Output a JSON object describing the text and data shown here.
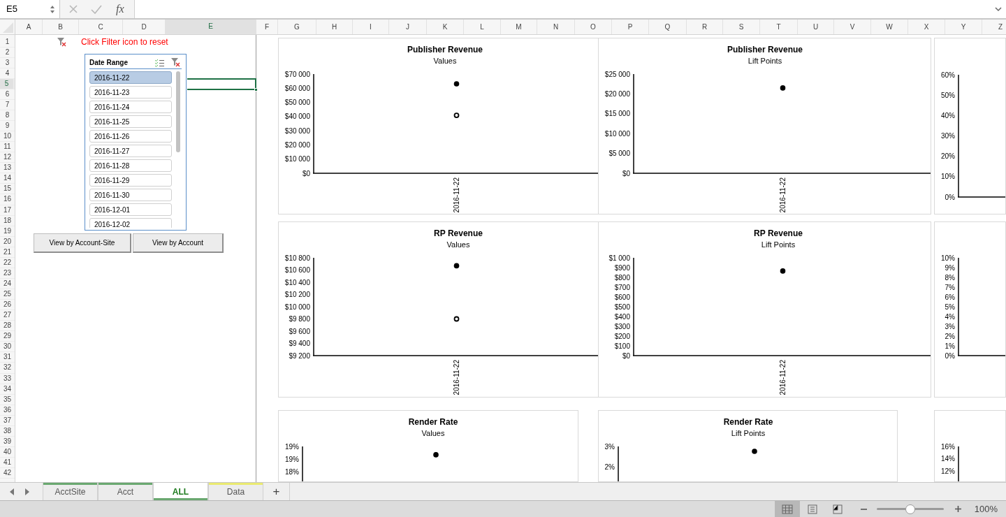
{
  "formula_bar": {
    "name_box": "E5",
    "function_label": "fx"
  },
  "columns": [
    {
      "label": "A",
      "selected": false
    },
    {
      "label": "B",
      "selected": false
    },
    {
      "label": "C",
      "selected": false
    },
    {
      "label": "D",
      "selected": false
    },
    {
      "label": "E",
      "selected": true
    },
    {
      "label": "F",
      "selected": false
    },
    {
      "label": "G",
      "selected": false
    },
    {
      "label": "H",
      "selected": false
    },
    {
      "label": "I",
      "selected": false
    },
    {
      "label": "J",
      "selected": false
    },
    {
      "label": "K",
      "selected": false
    },
    {
      "label": "L",
      "selected": false
    },
    {
      "label": "M",
      "selected": false
    },
    {
      "label": "N",
      "selected": false
    },
    {
      "label": "O",
      "selected": false
    },
    {
      "label": "P",
      "selected": false
    },
    {
      "label": "Q",
      "selected": false
    },
    {
      "label": "R",
      "selected": false
    },
    {
      "label": "S",
      "selected": false
    },
    {
      "label": "T",
      "selected": false
    },
    {
      "label": "U",
      "selected": false
    },
    {
      "label": "V",
      "selected": false
    },
    {
      "label": "W",
      "selected": false
    },
    {
      "label": "X",
      "selected": false
    },
    {
      "label": "Y",
      "selected": false
    },
    {
      "label": "Z",
      "selected": false
    }
  ],
  "rows": [
    {
      "label": "1",
      "selected": false
    },
    {
      "label": "2",
      "selected": false
    },
    {
      "label": "3",
      "selected": false
    },
    {
      "label": "4",
      "selected": false
    },
    {
      "label": "5",
      "selected": true
    },
    {
      "label": "6",
      "selected": false
    },
    {
      "label": "7",
      "selected": false
    },
    {
      "label": "8",
      "selected": false
    },
    {
      "label": "9",
      "selected": false
    },
    {
      "label": "10",
      "selected": false
    },
    {
      "label": "11",
      "selected": false
    },
    {
      "label": "12",
      "selected": false
    },
    {
      "label": "13",
      "selected": false
    },
    {
      "label": "14",
      "selected": false
    },
    {
      "label": "15",
      "selected": false
    },
    {
      "label": "16",
      "selected": false
    },
    {
      "label": "17",
      "selected": false
    },
    {
      "label": "18",
      "selected": false
    },
    {
      "label": "19",
      "selected": false
    },
    {
      "label": "20",
      "selected": false
    },
    {
      "label": "21",
      "selected": false
    },
    {
      "label": "22",
      "selected": false
    },
    {
      "label": "23",
      "selected": false
    },
    {
      "label": "24",
      "selected": false
    },
    {
      "label": "25",
      "selected": false
    },
    {
      "label": "26",
      "selected": false
    },
    {
      "label": "27",
      "selected": false
    },
    {
      "label": "28",
      "selected": false
    },
    {
      "label": "29",
      "selected": false
    },
    {
      "label": "30",
      "selected": false
    },
    {
      "label": "31",
      "selected": false
    },
    {
      "label": "32",
      "selected": false
    },
    {
      "label": "33",
      "selected": false
    },
    {
      "label": "34",
      "selected": false
    },
    {
      "label": "35",
      "selected": false
    },
    {
      "label": "36",
      "selected": false
    },
    {
      "label": "37",
      "selected": false
    },
    {
      "label": "38",
      "selected": false
    },
    {
      "label": "39",
      "selected": false
    },
    {
      "label": "40",
      "selected": false
    },
    {
      "label": "41",
      "selected": false
    },
    {
      "label": "42",
      "selected": false
    }
  ],
  "reset_note": "Click Filter icon to reset",
  "slicer": {
    "title": "Date Range",
    "items": [
      {
        "label": "2016-11-22",
        "selected": true
      },
      {
        "label": "2016-11-23",
        "selected": false
      },
      {
        "label": "2016-11-24",
        "selected": false
      },
      {
        "label": "2016-11-25",
        "selected": false
      },
      {
        "label": "2016-11-26",
        "selected": false
      },
      {
        "label": "2016-11-27",
        "selected": false
      },
      {
        "label": "2016-11-28",
        "selected": false
      },
      {
        "label": "2016-11-29",
        "selected": false
      },
      {
        "label": "2016-11-30",
        "selected": false
      },
      {
        "label": "2016-12-01",
        "selected": false
      },
      {
        "label": "2016-12-02",
        "selected": false
      }
    ]
  },
  "buttons": [
    "View by Account-Site",
    "View by Account"
  ],
  "charts": [
    {
      "subtitle": "Values",
      "x_label": "2016-11-22",
      "chart_data": {
        "type": "scatter",
        "title": "Publisher Revenue",
        "categories": [
          null
        ],
        "ylim": [
          0,
          70000
        ],
        "yticks": [
          {
            "value": 70000,
            "label": "$70 000"
          },
          {
            "value": 60000,
            "label": "$60 000"
          },
          {
            "value": 50000,
            "label": "$50 000"
          },
          {
            "value": 40000,
            "label": "$40 000"
          },
          {
            "value": 30000,
            "label": "$30 000"
          },
          {
            "value": 20000,
            "label": "$20 000"
          },
          {
            "value": 10000,
            "label": "$10 000"
          },
          {
            "value": 0,
            "label": "$0"
          }
        ],
        "series": [
          {
            "marker": "circle",
            "color": "#000000",
            "values": [
              63100
            ]
          },
          {
            "marker": "circle",
            "color": "#ffffff",
            "values": [
              40900
            ]
          }
        ]
      }
    },
    {
      "subtitle": "Lift Points",
      "x_label": "2016-11-22",
      "chart_data": {
        "type": "scatter",
        "title": "Publisher Revenue",
        "categories": [
          null
        ],
        "ylim": [
          0,
          25000
        ],
        "yticks": [
          {
            "value": 25000,
            "label": "$25 000"
          },
          {
            "value": 20000,
            "label": "$20 000"
          },
          {
            "value": 15000,
            "label": "$15 000"
          },
          {
            "value": 10000,
            "label": "$10 000"
          },
          {
            "value": 5000,
            "label": "$5 000"
          },
          {
            "value": 0,
            "label": "$0"
          }
        ],
        "series": [
          {
            "marker": "circle",
            "color": "#000000",
            "values": [
              21500
            ]
          }
        ]
      }
    },
    {
      "chart_data": {
        "type": "scatter",
        "categories": [
          null
        ],
        "ylim": [
          0,
          0.6
        ],
        "yticks": [
          {
            "value": 0.6,
            "label": "60%"
          },
          {
            "value": 0.5,
            "label": "50%"
          },
          {
            "value": 0.4,
            "label": "40%"
          },
          {
            "value": 0.3,
            "label": "30%"
          },
          {
            "value": 0.2,
            "label": "20%"
          },
          {
            "value": 0.1,
            "label": "10%"
          },
          {
            "value": 0,
            "label": "0%"
          }
        ]
      }
    },
    {
      "subtitle": "Values",
      "x_label": "2016-11-22",
      "chart_data": {
        "type": "scatter",
        "title": "RP Revenue",
        "categories": [
          null
        ],
        "ylim": [
          9200,
          10800
        ],
        "yticks": [
          {
            "value": 10800,
            "label": "$10 800"
          },
          {
            "value": 10600,
            "label": "$10 600"
          },
          {
            "value": 10400,
            "label": "$10 400"
          },
          {
            "value": 10200,
            "label": "$10 200"
          },
          {
            "value": 10000,
            "label": "$10 000"
          },
          {
            "value": 9800,
            "label": "$9 800"
          },
          {
            "value": 9600,
            "label": "$9 600"
          },
          {
            "value": 9400,
            "label": "$9 400"
          },
          {
            "value": 9200,
            "label": "$9 200"
          }
        ],
        "series": [
          {
            "marker": "circle",
            "color": "#000000",
            "values": [
              10670
            ]
          },
          {
            "marker": "circle",
            "color": "#ffffff",
            "values": [
              9800
            ]
          }
        ]
      }
    },
    {
      "subtitle": "Lift Points",
      "x_label": "2016-11-22",
      "chart_data": {
        "type": "scatter",
        "title": "RP Revenue",
        "categories": [
          null
        ],
        "ylim": [
          0,
          1000
        ],
        "yticks": [
          {
            "value": 1000,
            "label": "$1 000"
          },
          {
            "value": 900,
            "label": "$900"
          },
          {
            "value": 800,
            "label": "$800"
          },
          {
            "value": 700,
            "label": "$700"
          },
          {
            "value": 600,
            "label": "$600"
          },
          {
            "value": 500,
            "label": "$500"
          },
          {
            "value": 400,
            "label": "$400"
          },
          {
            "value": 300,
            "label": "$300"
          },
          {
            "value": 200,
            "label": "$200"
          },
          {
            "value": 100,
            "label": "$100"
          },
          {
            "value": 0,
            "label": "$0"
          }
        ],
        "series": [
          {
            "marker": "circle",
            "color": "#000000",
            "values": [
              865
            ]
          }
        ]
      }
    },
    {
      "chart_data": {
        "type": "scatter",
        "categories": [
          null
        ],
        "ylim": [
          0,
          0.1
        ],
        "yticks": [
          {
            "value": 0.1,
            "label": "10%"
          },
          {
            "value": 0.09,
            "label": "9%"
          },
          {
            "value": 0.08,
            "label": "8%"
          },
          {
            "value": 0.07,
            "label": "7%"
          },
          {
            "value": 0.06,
            "label": "6%"
          },
          {
            "value": 0.05,
            "label": "5%"
          },
          {
            "value": 0.04,
            "label": "4%"
          },
          {
            "value": 0.03,
            "label": "3%"
          },
          {
            "value": 0.02,
            "label": "2%"
          },
          {
            "value": 0.01,
            "label": "1%"
          },
          {
            "value": 0,
            "label": "0%"
          }
        ]
      }
    },
    {
      "subtitle": "Values",
      "chart_data": {
        "type": "scatter",
        "title": "Render Rate",
        "categories": [
          null
        ],
        "ylim": [
          0.1786,
          0.193
        ],
        "yticks": [
          {
            "value": 0.193,
            "label": "19%"
          },
          {
            "value": 0.188,
            "label": "19%"
          },
          {
            "value": 0.183,
            "label": "18%"
          }
        ],
        "series": [
          {
            "marker": "circle",
            "color": "#000000",
            "values": [
              0.1897
            ]
          }
        ]
      }
    },
    {
      "subtitle": "Lift Points",
      "chart_data": {
        "type": "scatter",
        "title": "Render Rate",
        "categories": [
          null
        ],
        "ylim": [
          0.0121,
          0.03
        ],
        "yticks": [
          {
            "value": 0.03,
            "label": "3%"
          },
          {
            "value": 0.02,
            "label": "2%"
          }
        ],
        "series": [
          {
            "marker": "circle",
            "color": "#000000",
            "values": [
              0.0276
            ]
          }
        ]
      }
    },
    {
      "axis_labels": [
        "16%",
        "14%",
        "12%"
      ]
    }
  ],
  "sheet_tabs": [
    {
      "label": "AcctSite",
      "color": "#6aa870",
      "selected": false
    },
    {
      "label": "Acct",
      "color": "#6aa870",
      "selected": false
    },
    {
      "label": "ALL",
      "color": "#6aa870",
      "selected": true
    },
    {
      "label": "Data",
      "color": "#eaea70",
      "selected": false
    }
  ],
  "add_sheet": "+",
  "status_bar": {
    "views": [
      {
        "kind": "normal",
        "selected": true
      },
      {
        "kind": "page_layout",
        "selected": false
      },
      {
        "kind": "page_break",
        "selected": false
      }
    ],
    "zoom": {
      "level": 0.5
    },
    "zoom_label": "100%"
  }
}
